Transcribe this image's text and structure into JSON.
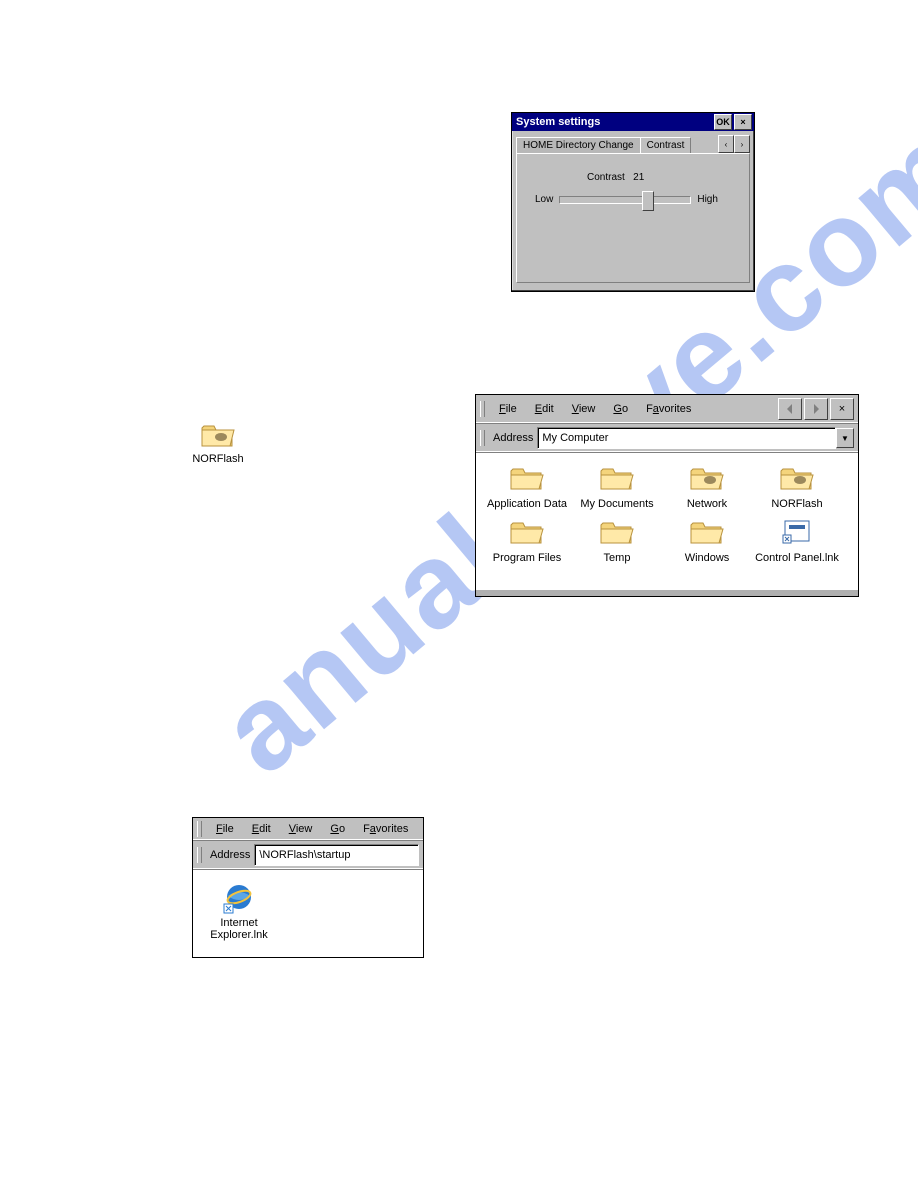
{
  "watermark": "anualshive.com",
  "settings_dialog": {
    "title": "System settings",
    "ok_label": "OK",
    "close_label": "×",
    "tabs": {
      "home_dir": "HOME Directory Change",
      "contrast": "Contrast",
      "scroll_left": "‹",
      "scroll_right": "›"
    },
    "contrast_label": "Contrast",
    "contrast_value": "21",
    "low_label": "Low",
    "high_label": "High"
  },
  "desktop_norflash_label": "NORFlash",
  "explorer": {
    "menu": {
      "file": "File",
      "edit": "Edit",
      "view": "View",
      "go": "Go",
      "favorites": "Favorites"
    },
    "address_label": "Address",
    "address_value": "My Computer",
    "close_label": "×",
    "items": [
      {
        "label": "Application Data",
        "type": "folder"
      },
      {
        "label": "My Documents",
        "type": "folder"
      },
      {
        "label": "Network",
        "type": "handfolder"
      },
      {
        "label": "NORFlash",
        "type": "handfolder"
      },
      {
        "label": "Program Files",
        "type": "folder"
      },
      {
        "label": "Temp",
        "type": "folder"
      },
      {
        "label": "Windows",
        "type": "folder"
      },
      {
        "label": "Control Panel.lnk",
        "type": "cpl"
      }
    ]
  },
  "explorer_small": {
    "menu": {
      "file": "File",
      "edit": "Edit",
      "view": "View",
      "go": "Go",
      "favorites": "Favorites"
    },
    "address_label": "Address",
    "address_value": "\\NORFlash\\startup",
    "item_label": "Internet Explorer.lnk"
  }
}
